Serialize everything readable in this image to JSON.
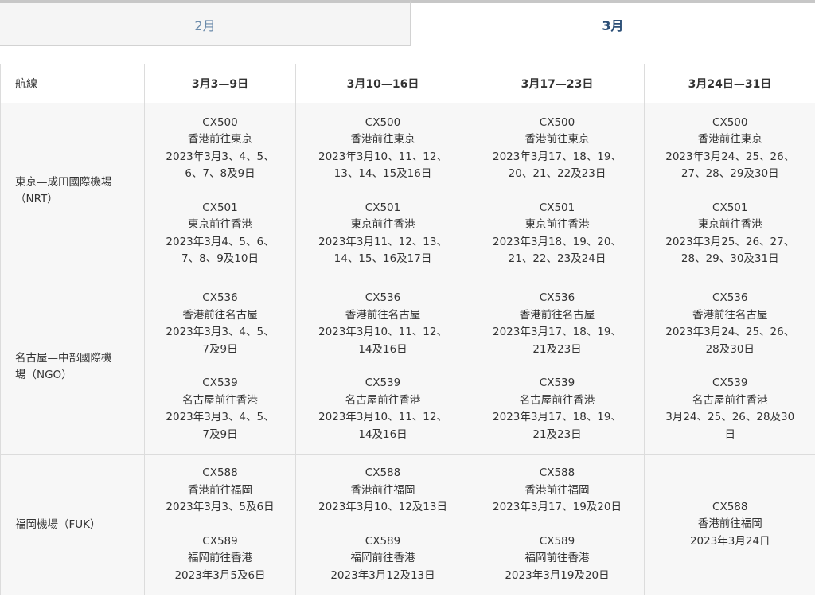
{
  "tabs": [
    {
      "label": "2月",
      "active": false
    },
    {
      "label": "3月",
      "active": true
    }
  ],
  "table": {
    "headers": [
      "航線",
      "3月3—9日",
      "3月10—16日",
      "3月17—23日",
      "3月24日—31日"
    ],
    "rows": [
      {
        "route_lines": [
          "東京—成田國際機場",
          "（NRT）"
        ],
        "cells": [
          [
            {
              "code": "CX500",
              "dir": "香港前往東京",
              "dates": [
                "2023年3月3、4、5、",
                "6、7、8及9日"
              ]
            },
            {
              "code": "CX501",
              "dir": "東京前往香港",
              "dates": [
                "2023年3月4、5、6、",
                "7、8、9及10日"
              ]
            }
          ],
          [
            {
              "code": "CX500",
              "dir": "香港前往東京",
              "dates": [
                "2023年3月10、11、12、",
                "13、14、15及16日"
              ]
            },
            {
              "code": "CX501",
              "dir": "東京前往香港",
              "dates": [
                "2023年3月11、12、13、",
                "14、15、16及17日"
              ]
            }
          ],
          [
            {
              "code": "CX500",
              "dir": "香港前往東京",
              "dates": [
                "2023年3月17、18、19、",
                "20、21、22及23日"
              ]
            },
            {
              "code": "CX501",
              "dir": "東京前往香港",
              "dates": [
                "2023年3月18、19、20、",
                "21、22、23及24日"
              ]
            }
          ],
          [
            {
              "code": "CX500",
              "dir": "香港前往東京",
              "dates": [
                "2023年3月24、25、26、",
                "27、28、29及30日"
              ]
            },
            {
              "code": "CX501",
              "dir": "東京前往香港",
              "dates": [
                "2023年3月25、26、27、",
                "28、29、30及31日"
              ]
            }
          ]
        ]
      },
      {
        "route_lines": [
          "名古屋—中部國際機",
          "場（NGO）"
        ],
        "cells": [
          [
            {
              "code": "CX536",
              "dir": "香港前往名古屋",
              "dates": [
                "2023年3月3、4、5、",
                "7及9日"
              ]
            },
            {
              "code": "CX539",
              "dir": "名古屋前往香港",
              "dates": [
                "2023年3月3、4、5、",
                "7及9日"
              ]
            }
          ],
          [
            {
              "code": "CX536",
              "dir": "香港前往名古屋",
              "dates": [
                "2023年3月10、11、12、",
                "14及16日"
              ]
            },
            {
              "code": "CX539",
              "dir": "名古屋前往香港",
              "dates": [
                "2023年3月10、11、12、",
                "14及16日"
              ]
            }
          ],
          [
            {
              "code": "CX536",
              "dir": "香港前往名古屋",
              "dates": [
                "2023年3月17、18、19、",
                "21及23日"
              ]
            },
            {
              "code": "CX539",
              "dir": "名古屋前往香港",
              "dates": [
                "2023年3月17、18、19、",
                "21及23日"
              ]
            }
          ],
          [
            {
              "code": "CX536",
              "dir": "香港前往名古屋",
              "dates": [
                "2023年3月24、25、26、",
                "28及30日"
              ]
            },
            {
              "code": "CX539",
              "dir": "名古屋前往香港",
              "dates": [
                "3月24、25、26、28及30",
                "日"
              ]
            }
          ]
        ]
      },
      {
        "route_lines": [
          "福岡機場（FUK）"
        ],
        "cells": [
          [
            {
              "code": "CX588",
              "dir": "香港前往福岡",
              "dates": [
                "2023年3月3、5及6日"
              ]
            },
            {
              "code": "CX589",
              "dir": "福岡前往香港",
              "dates": [
                "2023年3月5及6日"
              ]
            }
          ],
          [
            {
              "code": "CX588",
              "dir": "香港前往福岡",
              "dates": [
                "2023年3月10、12及13日"
              ]
            },
            {
              "code": "CX589",
              "dir": "福岡前往香港",
              "dates": [
                "2023年3月12及13日"
              ]
            }
          ],
          [
            {
              "code": "CX588",
              "dir": "香港前往福岡",
              "dates": [
                "2023年3月17、19及20日"
              ]
            },
            {
              "code": "CX589",
              "dir": "福岡前往香港",
              "dates": [
                "2023年3月19及20日"
              ]
            }
          ],
          [
            {
              "code": "CX588",
              "dir": "香港前往福岡",
              "dates": [
                "2023年3月24日"
              ]
            }
          ]
        ]
      }
    ]
  }
}
